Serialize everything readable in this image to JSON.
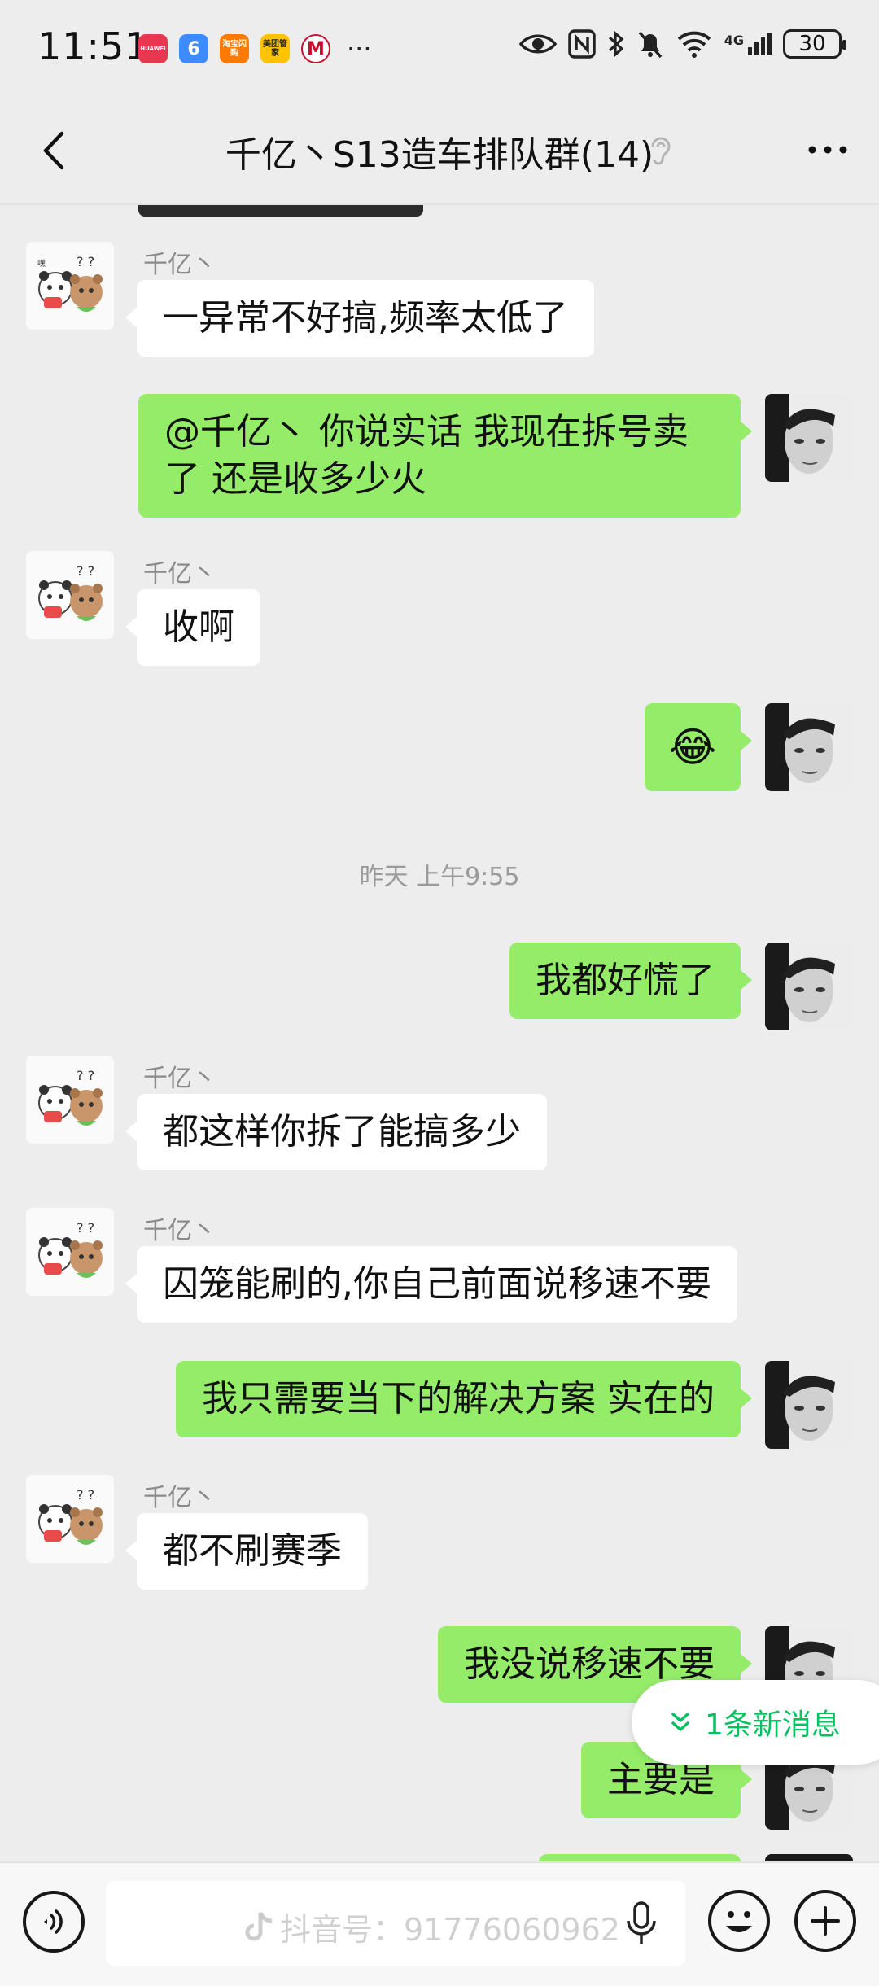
{
  "status_bar": {
    "time": "11:51",
    "apps": [
      {
        "name": "huawei-app",
        "label": "HUAWEI",
        "color": "#e8384f"
      },
      {
        "name": "blue-app",
        "label": "6",
        "color": "#3d8bff"
      },
      {
        "name": "taobao-flash-app",
        "label": "淘宝闪购",
        "color": "#ff7a00"
      },
      {
        "name": "meituan-app",
        "label": "美团管家",
        "color": "#ffc300"
      },
      {
        "name": "cmb-app",
        "label": "M",
        "color": "#ffffff"
      }
    ],
    "more": "···",
    "battery": "30",
    "network": "4G"
  },
  "header": {
    "title": "千亿丶S13造车排队群(14)"
  },
  "messages": [
    {
      "side": "left",
      "sender": "千亿丶",
      "text": "一异常不好搞,频率太低了"
    },
    {
      "side": "right",
      "line1": "@千亿丶  你说实话 我现在拆号卖",
      "line2": "了 还是收多少火"
    },
    {
      "side": "left",
      "sender": "千亿丶",
      "text": "收啊"
    },
    {
      "side": "right",
      "emoji": "😂"
    },
    {
      "timestamp": "昨天 上午9:55"
    },
    {
      "side": "right",
      "text": "我都好慌了"
    },
    {
      "side": "left",
      "sender": "千亿丶",
      "text": "都这样你拆了能搞多少"
    },
    {
      "side": "left",
      "sender": "千亿丶",
      "text": "囚笼能刷的,你自己前面说移速不要"
    },
    {
      "side": "right",
      "text": "我只需要当下的解决方案 实在的"
    },
    {
      "side": "left",
      "sender": "千亿丶",
      "text": "都不刷赛季"
    },
    {
      "side": "right",
      "text": "我没说移速不要"
    },
    {
      "side": "right",
      "text": "主要是"
    }
  ],
  "new_message_pill": "1条新消息",
  "input_bar": {
    "watermark": "抖音号：91776060962"
  },
  "colors": {
    "background": "#ededed",
    "green_bubble": "#95ec69",
    "white_bubble": "#ffffff",
    "accent": "#07c160"
  }
}
